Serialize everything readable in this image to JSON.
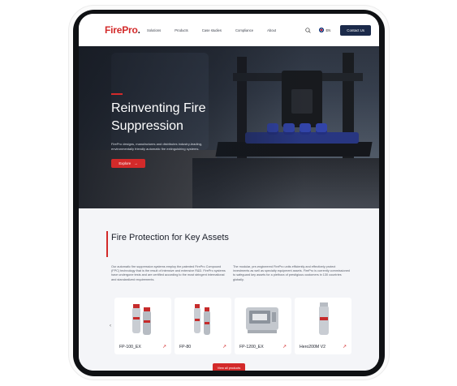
{
  "nav": {
    "logo_text": "FirePro",
    "logo_dot": ".",
    "links": [
      "Solutions",
      "Products",
      "Case studies",
      "Compliance",
      "About"
    ],
    "lang": "EN",
    "contact_label": "Contact Us"
  },
  "hero": {
    "title": "Reinventing Fire Suppression",
    "description": "FirePro designs, manufactures and distributes industry-leading, environmentally friendly automatic fire extinguishing systems.",
    "explore_label": "Explore",
    "explore_arrow": "→"
  },
  "section": {
    "title": "Fire Protection for Key Assets",
    "paragraph_1": "Our automatic fire suppression systems employ the patented FirePro Compound (FPC) technology that is the result of intensive and extensive R&D. FirePro systems have undergone tests and are certified according to the most stringent international and standardized requirements.",
    "paragraph_2": "The modular, pre-engineered FirePro units efficiently and effectively protect investments as well as specialty equipment assets. FirePro is currently commissioned to safeguard key assets for a plethora of prestigious customers in 130 countries globally.",
    "prev_arrow": "‹",
    "next_arrow": "›",
    "view_all_label": "View all products"
  },
  "products": [
    {
      "name": "FP-100_EX",
      "icon": "dual-cylinder-image"
    },
    {
      "name": "FP-80",
      "icon": "dual-cylinder-image"
    },
    {
      "name": "FP-1200_EX",
      "icon": "box-unit-image"
    },
    {
      "name": "Hero200M V2",
      "icon": "single-cylinder-image"
    }
  ],
  "product_link_arrow": "↗",
  "colors": {
    "brand_red": "#d32a2a",
    "nav_button": "#1b2a4a",
    "text_dark": "#1b1f2a"
  }
}
